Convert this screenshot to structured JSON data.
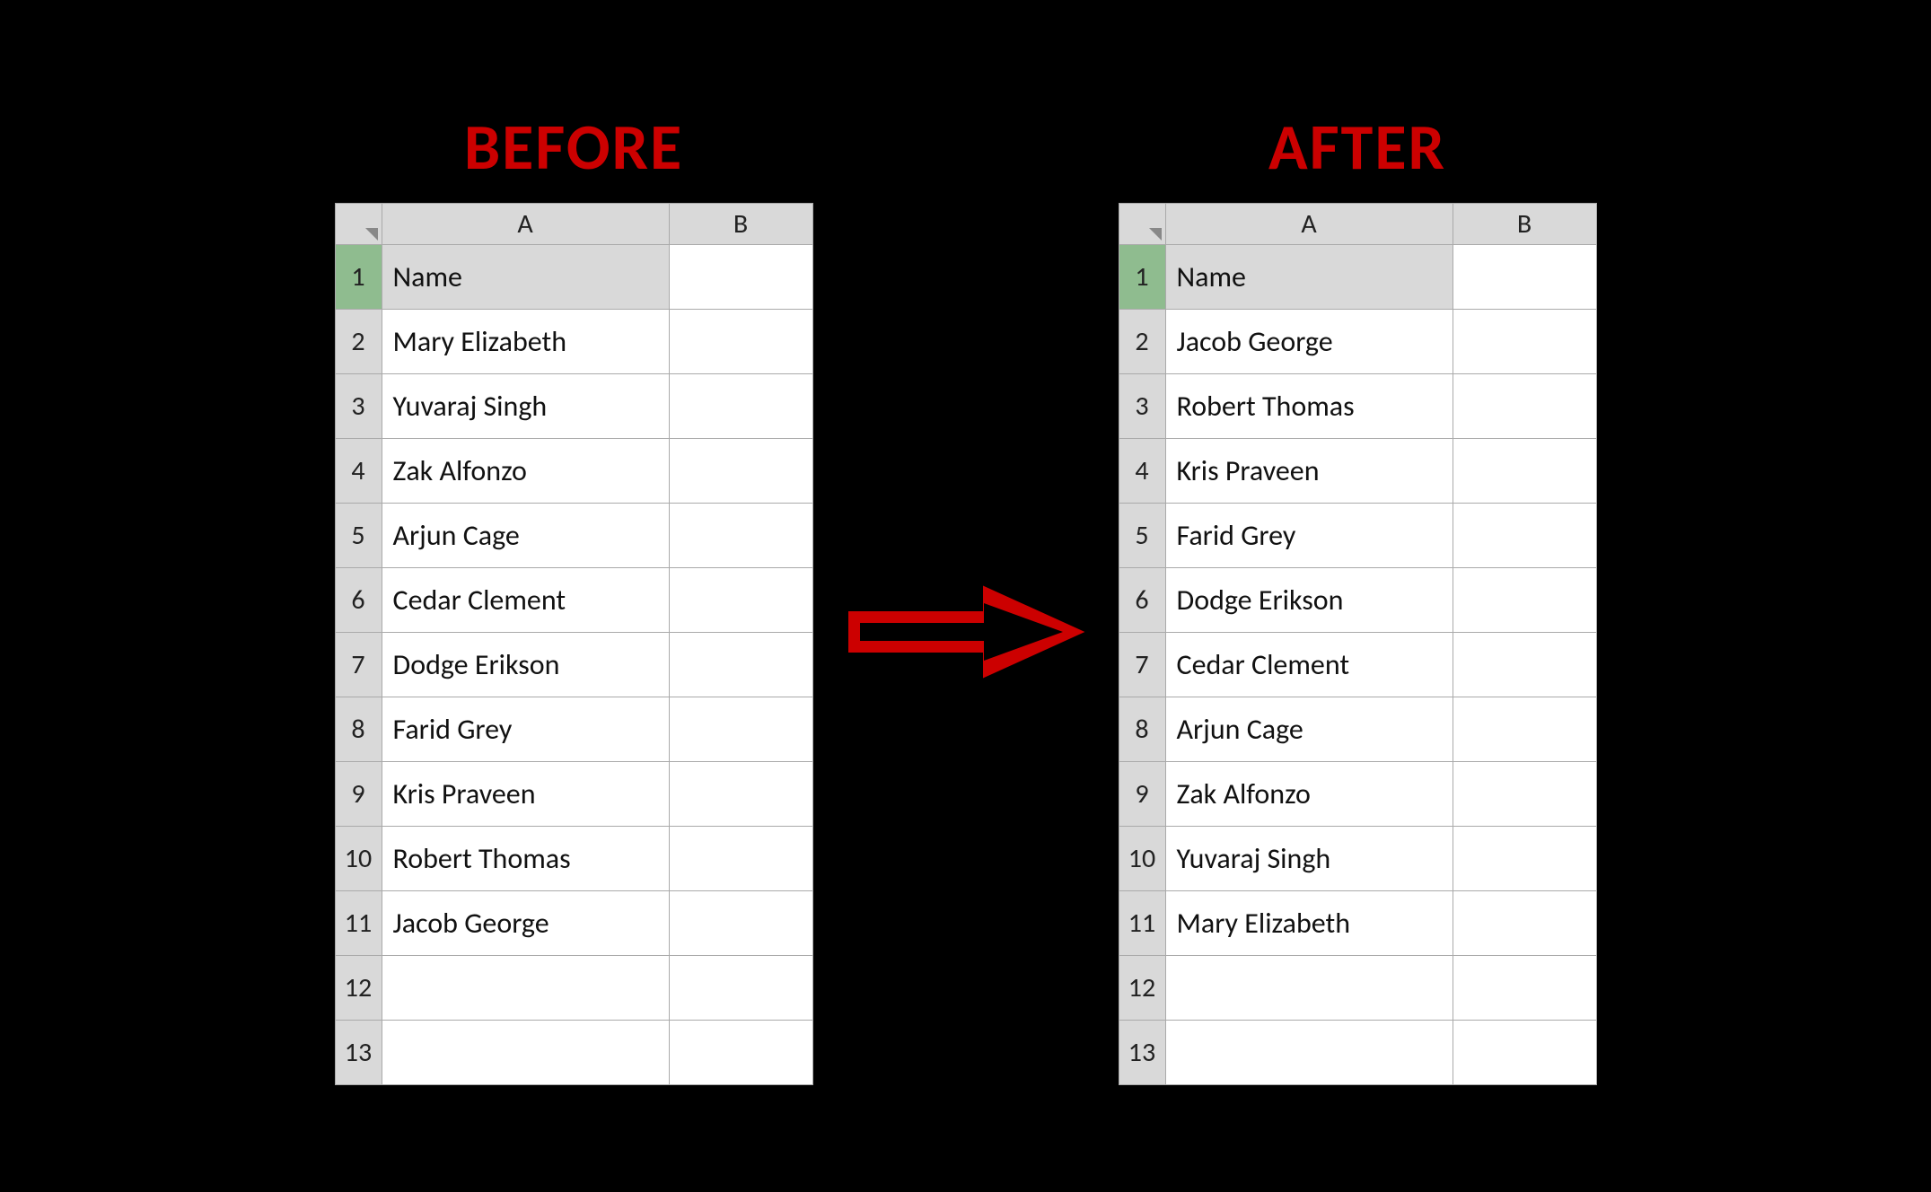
{
  "before": {
    "title": "BEFORE",
    "columns": [
      "A",
      "B"
    ],
    "rows": [
      {
        "row": "1",
        "a": "Name",
        "b": "",
        "highlighted": true
      },
      {
        "row": "2",
        "a": "Mary Elizabeth",
        "b": "",
        "highlighted": false
      },
      {
        "row": "3",
        "a": "Yuvaraj Singh",
        "b": "",
        "highlighted": false
      },
      {
        "row": "4",
        "a": "Zak Alfonzo",
        "b": "",
        "highlighted": false
      },
      {
        "row": "5",
        "a": "Arjun Cage",
        "b": "",
        "highlighted": false
      },
      {
        "row": "6",
        "a": "Cedar Clement",
        "b": "",
        "highlighted": false
      },
      {
        "row": "7",
        "a": "Dodge Erikson",
        "b": "",
        "highlighted": false
      },
      {
        "row": "8",
        "a": "Farid Grey",
        "b": "",
        "highlighted": false
      },
      {
        "row": "9",
        "a": "Kris Praveen",
        "b": "",
        "highlighted": false
      },
      {
        "row": "10",
        "a": "Robert Thomas",
        "b": "",
        "highlighted": false
      },
      {
        "row": "11",
        "a": "Jacob George",
        "b": "",
        "highlighted": false
      },
      {
        "row": "12",
        "a": "",
        "b": "",
        "highlighted": false
      },
      {
        "row": "13",
        "a": "",
        "b": "",
        "highlighted": false
      }
    ]
  },
  "after": {
    "title": "AFTER",
    "columns": [
      "A",
      "B"
    ],
    "rows": [
      {
        "row": "1",
        "a": "Name",
        "b": "",
        "highlighted": true
      },
      {
        "row": "2",
        "a": "Jacob George",
        "b": "",
        "highlighted": false
      },
      {
        "row": "3",
        "a": "Robert Thomas",
        "b": "",
        "highlighted": false
      },
      {
        "row": "4",
        "a": "Kris Praveen",
        "b": "",
        "highlighted": false
      },
      {
        "row": "5",
        "a": "Farid Grey",
        "b": "",
        "highlighted": false
      },
      {
        "row": "6",
        "a": "Dodge Erikson",
        "b": "",
        "highlighted": false
      },
      {
        "row": "7",
        "a": "Cedar Clement",
        "b": "",
        "highlighted": false
      },
      {
        "row": "8",
        "a": "Arjun Cage",
        "b": "",
        "highlighted": false
      },
      {
        "row": "9",
        "a": "Zak Alfonzo",
        "b": "",
        "highlighted": false
      },
      {
        "row": "10",
        "a": "Yuvaraj Singh",
        "b": "",
        "highlighted": false
      },
      {
        "row": "11",
        "a": "Mary Elizabeth",
        "b": "",
        "highlighted": false
      },
      {
        "row": "12",
        "a": "",
        "b": "",
        "highlighted": false
      },
      {
        "row": "13",
        "a": "",
        "b": "",
        "highlighted": false
      }
    ]
  },
  "arrow": {
    "label": "→"
  }
}
